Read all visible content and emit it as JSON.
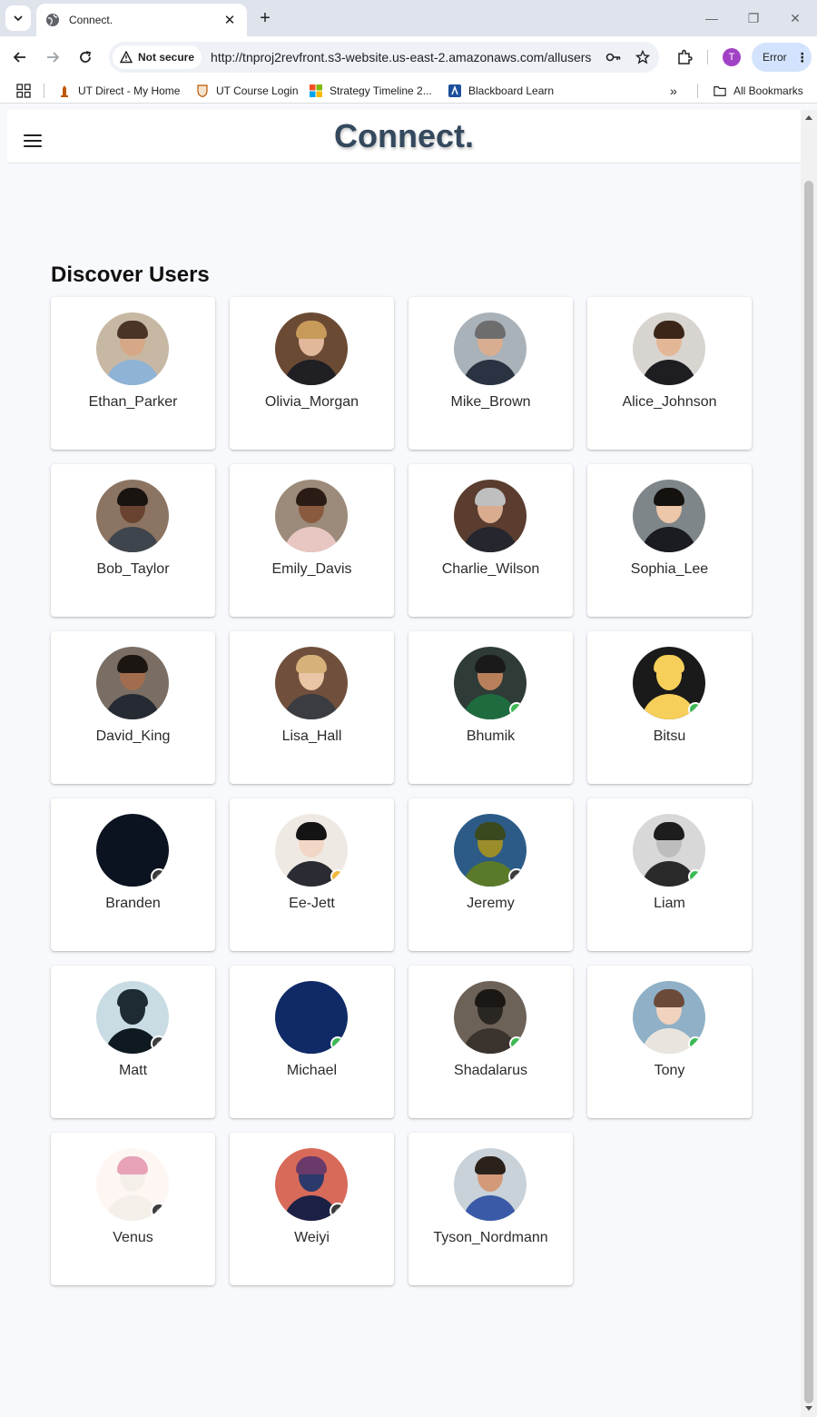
{
  "browser": {
    "tab_title": "Connect.",
    "security_chip": "Not secure",
    "url": "http://tnproj2revfront.s3-website.us-east-2.amazonaws.com/allusers",
    "profile_initial": "T",
    "error_label": "Error",
    "bookmarks": [
      {
        "label": "UT Direct - My Home",
        "icon": "ut-tower-icon"
      },
      {
        "label": "UT Course Login",
        "icon": "ut-shield-icon"
      },
      {
        "label": "Strategy Timeline 2...",
        "icon": "microsoft-icon"
      },
      {
        "label": "Blackboard Learn",
        "icon": "blackboard-icon"
      }
    ],
    "all_bookmarks_label": "All Bookmarks"
  },
  "app": {
    "brand": "Connect.",
    "section_title": "Discover Users",
    "users": [
      {
        "name": "Ethan_Parker",
        "avatar": {
          "bg": "#c7b8a4",
          "skin": "#d6a887",
          "hair": "#4a3426",
          "clothes": "#8fb3d6"
        },
        "status": ""
      },
      {
        "name": "Olivia_Morgan",
        "avatar": {
          "bg": "#6b4a34",
          "skin": "#e2b89a",
          "hair": "#c79a5a",
          "clothes": "#1f1f24"
        },
        "status": ""
      },
      {
        "name": "Mike_Brown",
        "avatar": {
          "bg": "#a9b1b9",
          "skin": "#d9ae90",
          "hair": "#6d6d6d",
          "clothes": "#2a3342"
        },
        "status": ""
      },
      {
        "name": "Alice_Johnson",
        "avatar": {
          "bg": "#d8d4cf",
          "skin": "#e3b796",
          "hair": "#3a2518",
          "clothes": "#1d1d22"
        },
        "status": ""
      },
      {
        "name": "Bob_Taylor",
        "avatar": {
          "bg": "#8c7462",
          "skin": "#6a4330",
          "hair": "#1a1410",
          "clothes": "#3f454d"
        },
        "status": ""
      },
      {
        "name": "Emily_Davis",
        "avatar": {
          "bg": "#9c8a7a",
          "skin": "#8a5a3e",
          "hair": "#2a1c14",
          "clothes": "#e8c7c3"
        },
        "status": ""
      },
      {
        "name": "Charlie_Wilson",
        "avatar": {
          "bg": "#5a3d2e",
          "skin": "#d9ac90",
          "hair": "#bfbfbf",
          "clothes": "#25262e"
        },
        "status": ""
      },
      {
        "name": "Sophia_Lee",
        "avatar": {
          "bg": "#7f8689",
          "skin": "#edc7a9",
          "hair": "#15110e",
          "clothes": "#1b1b22"
        },
        "status": ""
      },
      {
        "name": "David_King",
        "avatar": {
          "bg": "#7a6e64",
          "skin": "#a16d4e",
          "hair": "#1c1612",
          "clothes": "#252a33"
        },
        "status": ""
      },
      {
        "name": "Lisa_Hall",
        "avatar": {
          "bg": "#70503c",
          "skin": "#eac5a5",
          "hair": "#d6b27a",
          "clothes": "#3b3c42"
        },
        "status": ""
      },
      {
        "name": "Bhumik",
        "avatar": {
          "bg": "#2f3b37",
          "skin": "#b8805a",
          "hair": "#1a1a1a",
          "clothes": "#1f6b40"
        },
        "status": "online"
      },
      {
        "name": "Bitsu",
        "avatar": {
          "bg": "#1a1a1a",
          "skin": "#f6cf5a",
          "hair": "#f6cf5a",
          "clothes": "#f6cf5a"
        },
        "status": "online"
      },
      {
        "name": "Branden",
        "avatar": {
          "bg": "#0b1220",
          "skin": "#0b1220",
          "hair": "#0b1220",
          "clothes": "#0b1220"
        },
        "status": "offline"
      },
      {
        "name": "Ee-Jett",
        "avatar": {
          "bg": "#efe9e4",
          "skin": "#f3d7c6",
          "hair": "#141414",
          "clothes": "#2b2b33"
        },
        "status": "away"
      },
      {
        "name": "Jeremy",
        "avatar": {
          "bg": "#2c5b88",
          "skin": "#9b8d2a",
          "hair": "#3a4a1e",
          "clothes": "#5a7a2a"
        },
        "status": "offline"
      },
      {
        "name": "Liam",
        "avatar": {
          "bg": "#d8d8d8",
          "skin": "#bdbdbd",
          "hair": "#1d1d1d",
          "clothes": "#2a2a2a"
        },
        "status": "online"
      },
      {
        "name": "Matt",
        "avatar": {
          "bg": "#c9dbe3",
          "skin": "#1e2b33",
          "hair": "#1e2b33",
          "clothes": "#0f1a20"
        },
        "status": "offline"
      },
      {
        "name": "Michael",
        "avatar": {
          "bg": "#0f2a66",
          "skin": "#0f2a66",
          "hair": "#0f2a66",
          "clothes": "#0f2a66"
        },
        "status": "online"
      },
      {
        "name": "Shadalarus",
        "avatar": {
          "bg": "#6d6258",
          "skin": "#2a2622",
          "hair": "#1a1714",
          "clothes": "#3b342e"
        },
        "status": "online"
      },
      {
        "name": "Tony",
        "avatar": {
          "bg": "#8fb0c6",
          "skin": "#f0d2bf",
          "hair": "#6b4a3a",
          "clothes": "#e9e5de"
        },
        "status": "online"
      },
      {
        "name": "Venus",
        "avatar": {
          "bg": "#fdf6f3",
          "skin": "#f5efe9",
          "hair": "#e7a2b8",
          "clothes": "#f5efe9"
        },
        "status": "offline"
      },
      {
        "name": "Weiyi",
        "avatar": {
          "bg": "#d86a5a",
          "skin": "#2c3a6b",
          "hair": "#6a3a6a",
          "clothes": "#1b2145"
        },
        "status": "offline"
      },
      {
        "name": "Tyson_Nordmann",
        "avatar": {
          "bg": "#c9d2d8",
          "skin": "#d39a7a",
          "hair": "#2b211b",
          "clothes": "#3a5aa8"
        },
        "status": ""
      }
    ]
  },
  "colors": {
    "brand": "#34495e",
    "online": "#3cba54",
    "away": "#f2b73a",
    "offline": "#3c3c3c"
  }
}
